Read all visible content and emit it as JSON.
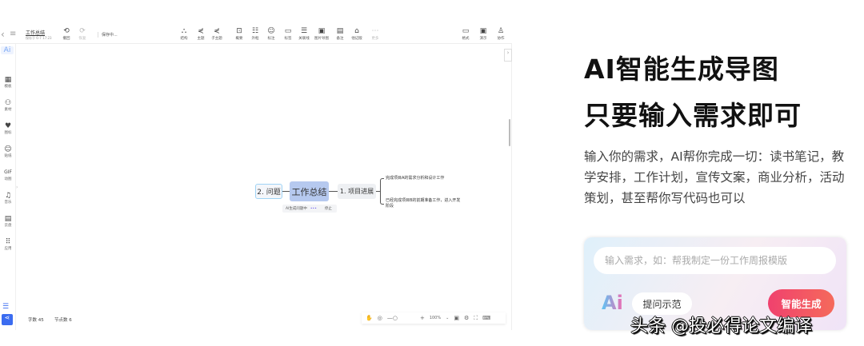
{
  "app": {
    "back": "‹",
    "menu": "≡",
    "doc_title": "工作总结",
    "saved_at": "保存于 6-7 17:23",
    "undo": "撤回",
    "redo": "恢复",
    "status": "保存中...",
    "tools": [
      "结构",
      "主题",
      "子主题",
      "概要",
      "外框",
      "标注",
      "标签",
      "关联线",
      "图片导图",
      "备注",
      "他记版",
      "更多"
    ],
    "right_tools": [
      "格式",
      "演示",
      "协作"
    ],
    "sidebar": [
      "模板",
      "素材",
      "图标",
      "贴纸",
      "动图",
      "音乐",
      "云盘",
      "应用"
    ],
    "ai_badge": "Ai",
    "mindmap": {
      "center": "工作总结",
      "left": "2. 问题",
      "right": "1. 项目进展",
      "leaves": [
        "完成项目A的需求分析和设计工作",
        "已经完成项目B的前期准备工作，进入开发阶段"
      ],
      "ai_status": "AI生成问题中",
      "stop": "停止"
    },
    "word_count": "字数 45",
    "node_count": "节点数 6",
    "zoom": "100%"
  },
  "promo": {
    "title1": "AI智能生成导图",
    "title2": "只要输入需求即可",
    "desc": "输入你的需求，AI帮你完成一切：读书笔记，教学安排，工作计划，宣传文案，商业分析，活动策划，甚至帮你写代码也可以",
    "placeholder": "输入需求，如：帮我制定一份工作周报模版",
    "ai_logo": "Ai",
    "example": "提问示范",
    "generate": "智能生成"
  },
  "watermark": "头条 @投必得论文编译"
}
